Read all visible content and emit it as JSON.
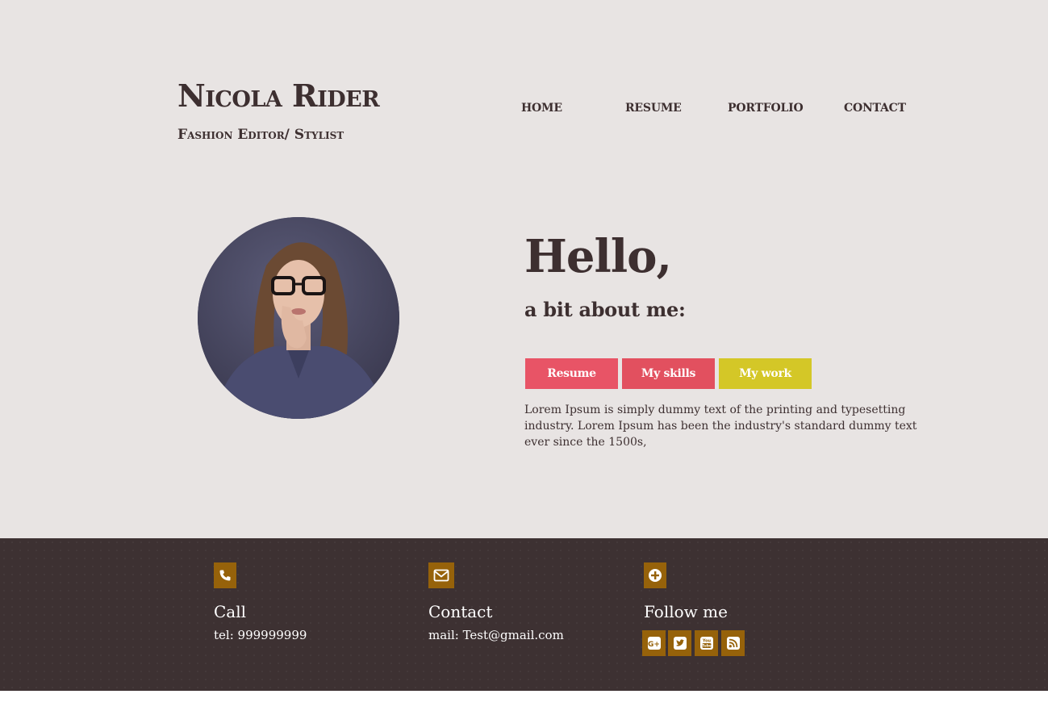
{
  "header": {
    "name": "Nicola Rider",
    "subtitle": "Fashion Editor/ Stylist"
  },
  "nav": {
    "items": [
      "HOME",
      "RESUME",
      "PORTFOLIO",
      "CONTACT"
    ]
  },
  "intro": {
    "greeting": "Hello,",
    "about": "a bit about me:",
    "buttons": [
      "Resume",
      "My skills",
      "My work"
    ],
    "body": "Lorem Ipsum is simply dummy text of the printing and typesetting industry. Lorem Ipsum has been the industry's standard dummy text ever since the 1500s,"
  },
  "footer": {
    "call": {
      "title": "Call",
      "text": "tel: 999999999",
      "icon": "phone-icon"
    },
    "contact": {
      "title": "Contact",
      "text": "mail: Test@gmail.com",
      "icon": "envelope-icon"
    },
    "follow": {
      "title": "Follow me",
      "icon": "plus-circle-icon",
      "social": [
        "google-plus-icon",
        "twitter-icon",
        "youtube-icon",
        "rss-icon"
      ]
    }
  },
  "colors": {
    "hero_bg": "#e8e4e3",
    "text_dark": "#3d2f30",
    "btn_resume": "#e85466",
    "btn_skills": "#e2505f",
    "btn_work": "#d4c727",
    "footer_bg": "#3d3132",
    "icon_bg": "#96620a"
  }
}
